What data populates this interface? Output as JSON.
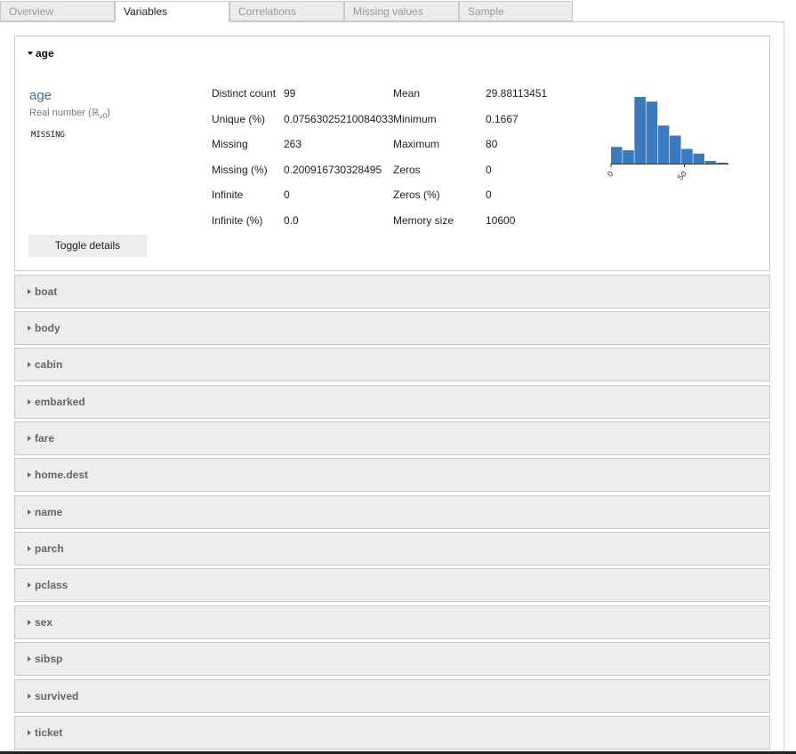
{
  "tabs": [
    {
      "label": "Overview",
      "active": false
    },
    {
      "label": "Variables",
      "active": true
    },
    {
      "label": "Correlations",
      "active": false
    },
    {
      "label": "Missing values",
      "active": false
    },
    {
      "label": "Sample",
      "active": false
    }
  ],
  "variable": {
    "header": "age",
    "name": "age",
    "type_label": "Real number (ℝ",
    "type_sub": "≥0",
    "type_close": ")",
    "warning": "MISSING",
    "stats": [
      {
        "label": "Distinct count",
        "value": "99",
        "label2": "Mean",
        "value2": "29.88113451"
      },
      {
        "label": "Unique (%)",
        "value": "0.07563025210084033",
        "label2": "Minimum",
        "value2": "0.1667"
      },
      {
        "label": "Missing",
        "value": "263",
        "label2": "Maximum",
        "value2": "80"
      },
      {
        "label": "Missing (%)",
        "value": "0.200916730328495",
        "label2": "Zeros",
        "value2": "0"
      },
      {
        "label": "Infinite",
        "value": "0",
        "label2": "Zeros (%)",
        "value2": "0"
      },
      {
        "label": "Infinite (%)",
        "value": "0.0",
        "label2": "Memory size",
        "value2": "10600"
      }
    ],
    "toggle_label": "Toggle details"
  },
  "histogram": {
    "color": "#3c7abf",
    "range": [
      0,
      80
    ],
    "tick_labels": [
      "0",
      "50"
    ],
    "tick_values": [
      0,
      50
    ],
    "bins": [
      0.25,
      0.2,
      1.0,
      0.93,
      0.57,
      0.42,
      0.22,
      0.15,
      0.04,
      0.015
    ]
  },
  "collapsed_variables": [
    "boat",
    "body",
    "cabin",
    "embarked",
    "fare",
    "home.dest",
    "name",
    "parch",
    "pclass",
    "sex",
    "sibsp",
    "survived",
    "ticket"
  ]
}
